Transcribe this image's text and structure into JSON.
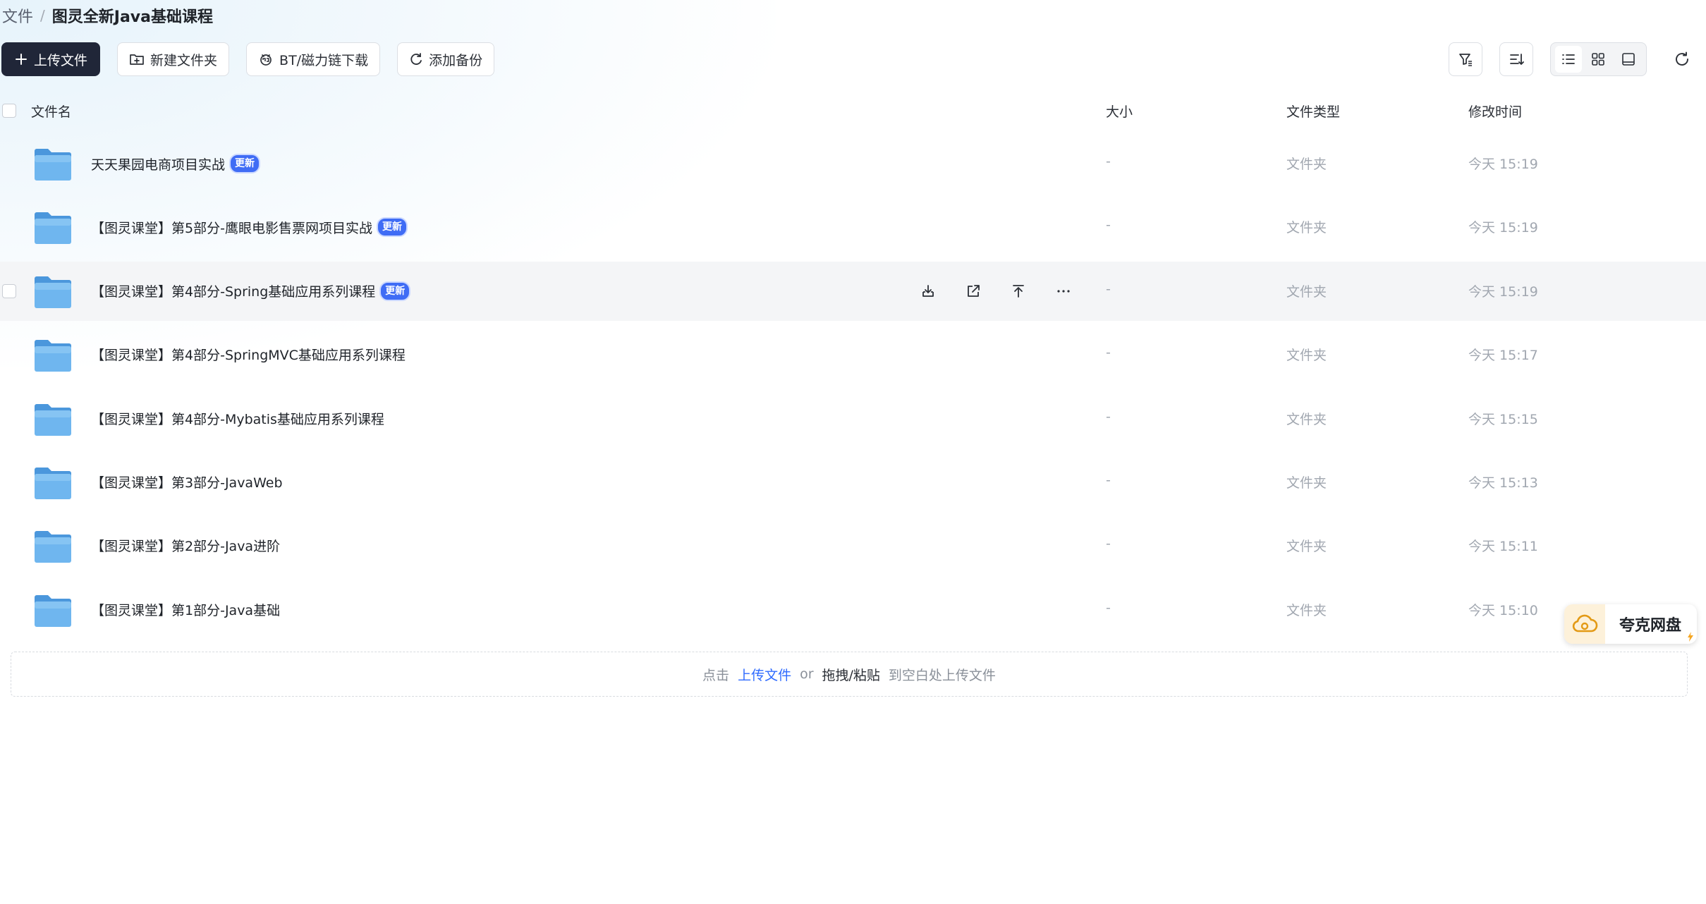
{
  "breadcrumb": {
    "root": "文件",
    "separator": "/",
    "current": "图灵全新Java基础课程"
  },
  "toolbar": {
    "upload": "上传文件",
    "new_folder": "新建文件夹",
    "bt_download": "BT/磁力链下载",
    "add_backup": "添加备份"
  },
  "columns": {
    "name": "文件名",
    "size": "大小",
    "type": "文件类型",
    "modified": "修改时间"
  },
  "rows": [
    {
      "name": "天天果园电商项目实战",
      "badge": "更新",
      "size": "-",
      "type": "文件夹",
      "modified": "今天 15:19"
    },
    {
      "name": "【图灵课堂】第5部分-鹰眼电影售票网项目实战",
      "badge": "更新",
      "size": "-",
      "type": "文件夹",
      "modified": "今天 15:19"
    },
    {
      "name": "【图灵课堂】第4部分-Spring基础应用系列课程",
      "badge": "更新",
      "size": "-",
      "type": "文件夹",
      "modified": "今天 15:19"
    },
    {
      "name": "【图灵课堂】第4部分-SpringMVC基础应用系列课程",
      "badge": "",
      "size": "-",
      "type": "文件夹",
      "modified": "今天 15:17"
    },
    {
      "name": "【图灵课堂】第4部分-Mybatis基础应用系列课程",
      "badge": "",
      "size": "-",
      "type": "文件夹",
      "modified": "今天 15:15"
    },
    {
      "name": "【图灵课堂】第3部分-JavaWeb",
      "badge": "",
      "size": "-",
      "type": "文件夹",
      "modified": "今天 15:13"
    },
    {
      "name": "【图灵课堂】第2部分-Java进阶",
      "badge": "",
      "size": "-",
      "type": "文件夹",
      "modified": "今天 15:11"
    },
    {
      "name": "【图灵课堂】第1部分-Java基础",
      "badge": "",
      "size": "-",
      "type": "文件夹",
      "modified": "今天 15:10"
    }
  ],
  "hovered_row": 2,
  "dropzone": {
    "click": "点击",
    "upload_link": "上传文件",
    "or": "or",
    "drag_paste": "拖拽/粘贴",
    "tail": "到空白处上传文件"
  },
  "quark_widget": {
    "label": "夸克网盘"
  },
  "icons": {
    "upload": "plus-icon",
    "new_folder": "folder-plus-icon",
    "bt": "magnet-icon",
    "backup": "sync-icon",
    "filter": "filter-icon",
    "sort": "sort-icon",
    "list_view": "list-view-icon",
    "grid_view": "grid-view-icon",
    "preview_view": "preview-view-icon",
    "refresh": "refresh-icon",
    "row_actions": [
      "download-icon",
      "share-icon",
      "move-up-icon",
      "more-icon"
    ]
  },
  "colors": {
    "primary_button": "#202638",
    "badge": "#3f6cf5",
    "link": "#2f6bff",
    "folder": "#5aa8e8",
    "quark_accent": "#f5a623"
  }
}
